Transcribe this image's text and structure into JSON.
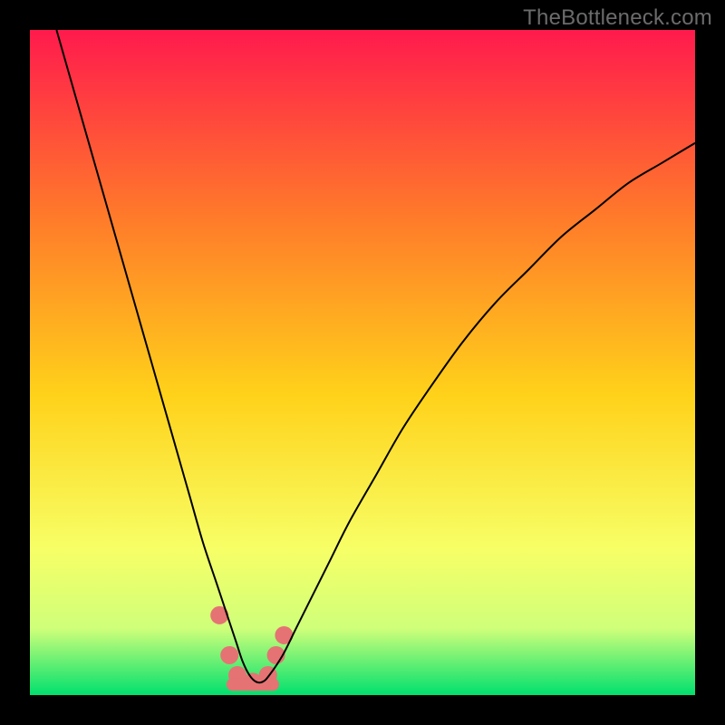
{
  "watermark": "TheBottleneck.com",
  "chart_data": {
    "type": "line",
    "title": "",
    "xlabel": "",
    "ylabel": "",
    "xlim": [
      0,
      100
    ],
    "ylim": [
      0,
      100
    ],
    "background_gradient": {
      "top": "#ff1a4d",
      "upper_mid": "#ff7a2a",
      "mid": "#ffd21a",
      "lower": "#f7ff66",
      "lower2": "#cfff7a",
      "bottom": "#00e06e"
    },
    "series": [
      {
        "name": "bottleneck-curve",
        "color": "#000000",
        "x": [
          4,
          6,
          8,
          10,
          12,
          14,
          16,
          18,
          20,
          22,
          24,
          26,
          28,
          30,
          31,
          32,
          33,
          34,
          35,
          36,
          38,
          40,
          42,
          45,
          48,
          52,
          56,
          60,
          65,
          70,
          75,
          80,
          85,
          90,
          95,
          100
        ],
        "values": [
          100,
          93,
          86,
          79,
          72,
          65,
          58,
          51,
          44,
          37,
          30,
          23,
          17,
          11,
          8,
          5,
          3,
          2,
          2,
          3,
          6,
          10,
          14,
          20,
          26,
          33,
          40,
          46,
          53,
          59,
          64,
          69,
          73,
          77,
          80,
          83
        ]
      }
    ],
    "markers": {
      "name": "highlight-dots",
      "color": "#e57373",
      "radius": 10,
      "points": [
        {
          "x": 28.5,
          "y": 12
        },
        {
          "x": 30.0,
          "y": 6
        },
        {
          "x": 31.2,
          "y": 3
        },
        {
          "x": 33.5,
          "y": 2
        },
        {
          "x": 35.8,
          "y": 3
        },
        {
          "x": 37.0,
          "y": 6
        },
        {
          "x": 38.2,
          "y": 9
        }
      ]
    },
    "flat_segment": {
      "name": "bottom-bar",
      "color": "#e57373",
      "y": 1.6,
      "x_start": 30.5,
      "x_end": 36.5,
      "thickness": 14
    }
  }
}
